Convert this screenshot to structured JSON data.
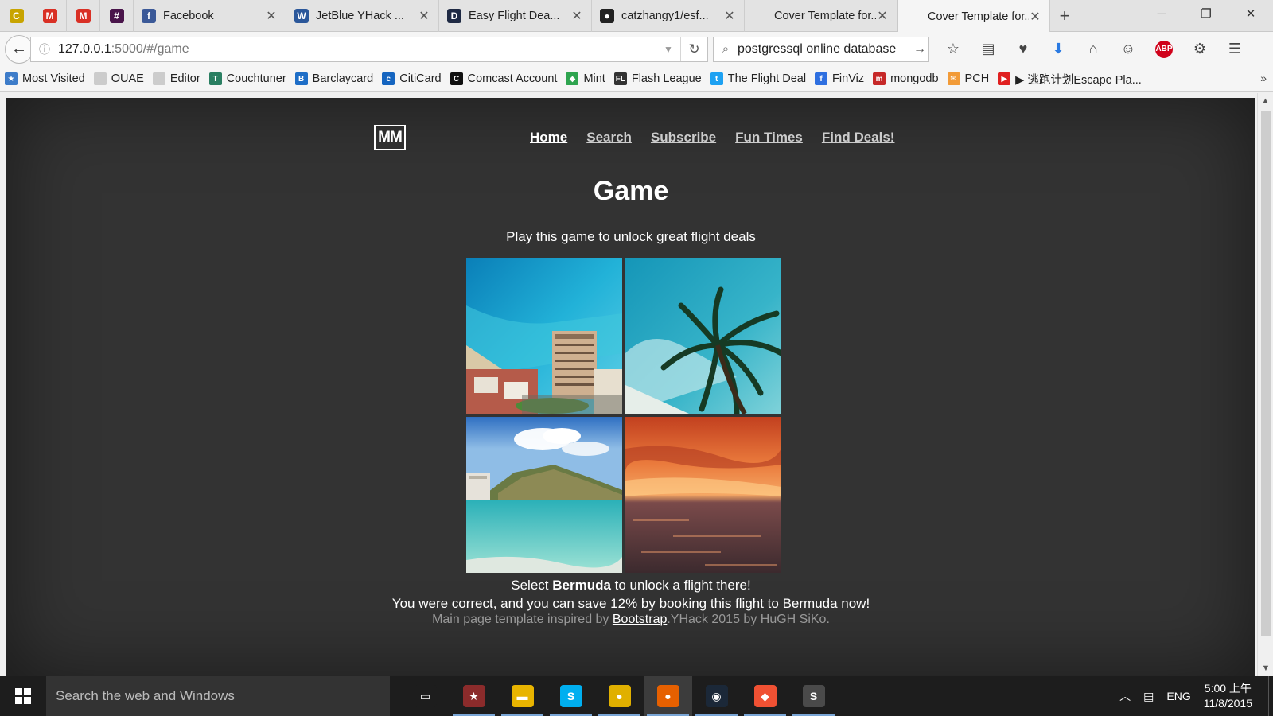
{
  "browser": {
    "pinned_tabs": [
      {
        "icon": "cal-icon",
        "color": "#c8a400",
        "glyph": "C"
      },
      {
        "icon": "gmail-icon",
        "color": "#d93025",
        "glyph": "M"
      },
      {
        "icon": "gmail-icon",
        "color": "#d93025",
        "glyph": "M"
      },
      {
        "icon": "slack-icon",
        "color": "#4a154b",
        "glyph": "#"
      }
    ],
    "tabs": [
      {
        "title": "Facebook",
        "icon": "facebook-icon",
        "color": "#3b5998",
        "glyph": "f"
      },
      {
        "title": "JetBlue YHack ...",
        "icon": "word-icon",
        "color": "#2b579a",
        "glyph": "W"
      },
      {
        "title": "Easy Flight Dea...",
        "icon": "d-icon",
        "color": "#1f2a44",
        "glyph": "D"
      },
      {
        "title": "catzhangy1/esf...",
        "icon": "github-icon",
        "color": "#222222",
        "glyph": "●"
      },
      {
        "title": "Cover Template for...",
        "icon": "blank-icon",
        "color": "#e3e3e3",
        "glyph": ""
      },
      {
        "title": "Cover Template for...",
        "icon": "blank-icon",
        "color": "#f5f5f5",
        "glyph": "",
        "active": true
      }
    ],
    "url_host": "127.0.0.1",
    "url_path": ":5000/#/game",
    "search_query": "postgressql online database"
  },
  "bookmarks": [
    {
      "label": "Most Visited",
      "color": "#3d7cc9",
      "glyph": "★"
    },
    {
      "label": "OUAE",
      "color": "#cccccc",
      "glyph": ""
    },
    {
      "label": "Editor",
      "color": "#cccccc",
      "glyph": ""
    },
    {
      "label": "Couchtuner",
      "color": "#2a7f62",
      "glyph": "T"
    },
    {
      "label": "Barclaycard",
      "color": "#1e6ec7",
      "glyph": "B"
    },
    {
      "label": "CitiCard",
      "color": "#1565c0",
      "glyph": "c"
    },
    {
      "label": "Comcast Account",
      "color": "#111111",
      "glyph": "C"
    },
    {
      "label": "Mint",
      "color": "#2ea44f",
      "glyph": "◆"
    },
    {
      "label": "Flash League",
      "color": "#333333",
      "glyph": "FL"
    },
    {
      "label": "The Flight Deal",
      "color": "#1da1f2",
      "glyph": "t"
    },
    {
      "label": "FinViz",
      "color": "#2e6fe0",
      "glyph": "f"
    },
    {
      "label": "mongodb",
      "color": "#c62828",
      "glyph": "m"
    },
    {
      "label": "PCH",
      "color": "#f29b38",
      "glyph": "✉"
    },
    {
      "label": "▶ 逃跑计划Escape Pla...",
      "color": "#e02020",
      "glyph": "▶"
    }
  ],
  "site": {
    "brand": "MM",
    "nav": [
      {
        "label": "Home",
        "active": true
      },
      {
        "label": "Search"
      },
      {
        "label": "Subscribe"
      },
      {
        "label": "Fun Times"
      },
      {
        "label": "Find Deals!"
      }
    ],
    "title": "Game",
    "lead": "Play this game to unlock great flight deals",
    "prompt_before": "Select ",
    "prompt_place": "Bermuda",
    "prompt_after": " to unlock a flight there!",
    "result": "You were correct, and you can save 12% by booking this flight to Bermuda now!",
    "footer_before": "Main page template inspired by ",
    "footer_link": "Bootstrap",
    "footer_after": ".YHack 2015 by HuGH SiKo.",
    "tiles": [
      "resort-hotel-photo",
      "palm-tree-photo",
      "beach-mountain-photo",
      "sunset-ocean-photo"
    ]
  },
  "taskbar": {
    "search_placeholder": "Search the web and Windows",
    "apps": [
      {
        "name": "task-view-icon",
        "color": "#1d1d1d",
        "glyph": "▭"
      },
      {
        "name": "game-app-icon",
        "color": "#8b2b2b",
        "glyph": "★"
      },
      {
        "name": "file-explorer-icon",
        "color": "#e8b400",
        "glyph": "▬"
      },
      {
        "name": "skype-icon",
        "color": "#00aff0",
        "glyph": "S"
      },
      {
        "name": "chrome-canary-icon",
        "color": "#e0b000",
        "glyph": "●"
      },
      {
        "name": "firefox-icon",
        "color": "#e66000",
        "glyph": "●",
        "focused": true
      },
      {
        "name": "steam-icon",
        "color": "#1b2838",
        "glyph": "◉"
      },
      {
        "name": "git-icon",
        "color": "#f05133",
        "glyph": "◆"
      },
      {
        "name": "sublime-icon",
        "color": "#4a4a4a",
        "glyph": "S"
      }
    ],
    "lang": "ENG",
    "time": "5:00 上午",
    "date": "11/8/2015"
  }
}
